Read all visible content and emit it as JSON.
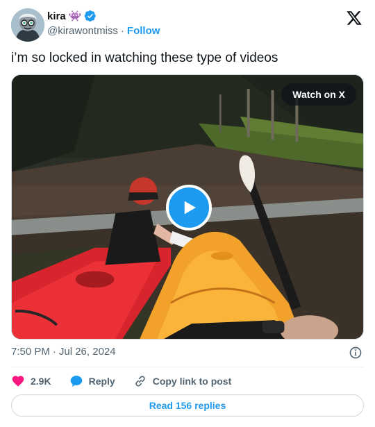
{
  "author": {
    "display_name": "kira",
    "name_emoji": "👾",
    "handle": "@kirawontmiss",
    "separator": "·",
    "follow_label": "Follow",
    "verified": true
  },
  "tweet": {
    "text": "i’m so locked in watching these type of videos"
  },
  "media": {
    "type": "video",
    "watch_label": "Watch on X"
  },
  "meta": {
    "time": "7:50 PM",
    "separator": "·",
    "date": "Jul 26, 2024"
  },
  "actions": {
    "likes": "2.9K",
    "reply_label": "Reply",
    "copy_label": "Copy link to post"
  },
  "footer": {
    "read_replies_label": "Read 156 replies"
  },
  "colors": {
    "accent": "#1d9bf0",
    "like": "#f91880",
    "text_primary": "#0f1419",
    "text_secondary": "#536471",
    "border": "#cfd9de"
  },
  "icons": {
    "logo": "x-logo-icon",
    "verified": "verified-badge-icon",
    "play": "play-icon",
    "info": "info-icon",
    "like": "heart-icon",
    "reply": "speech-bubble-icon",
    "copy": "link-icon"
  }
}
